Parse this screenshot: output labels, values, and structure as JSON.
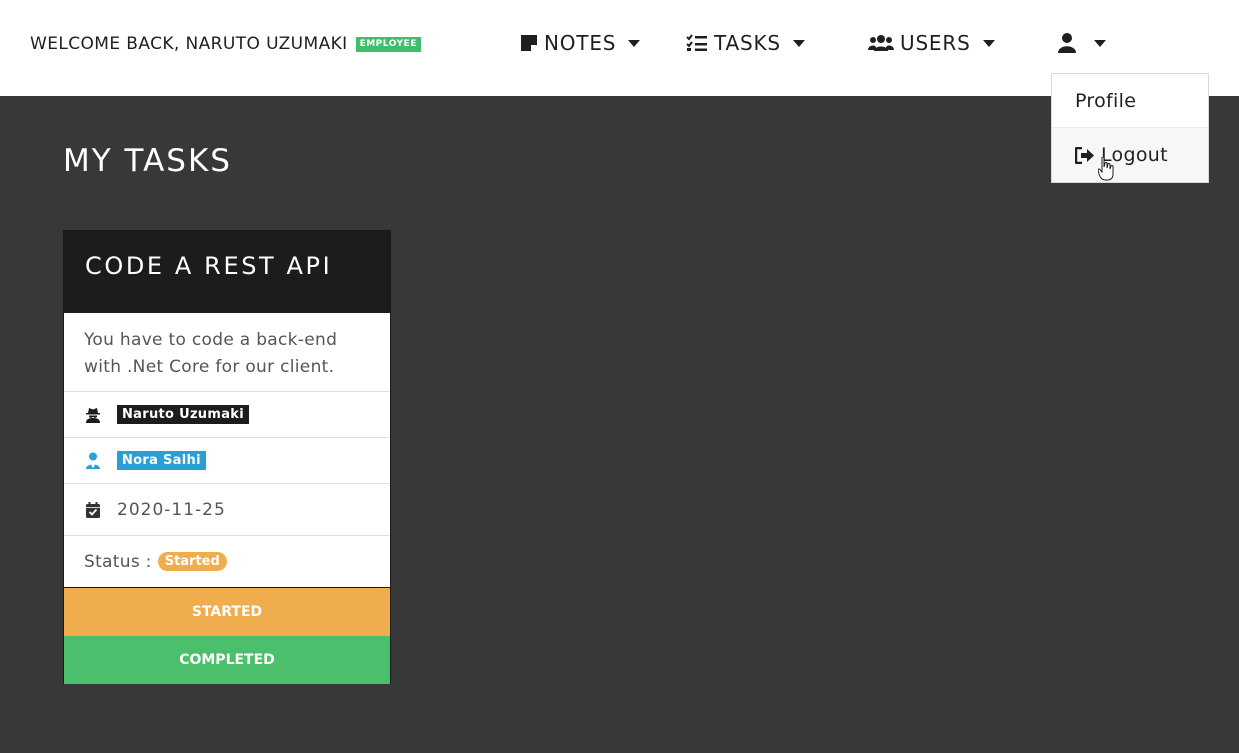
{
  "header": {
    "welcome": "WELCOME BACK, NARUTO UZUMAKI",
    "role_badge": "EMPLOYEE"
  },
  "nav": {
    "notes": "NOTES",
    "tasks": "TASKS",
    "users": "USERS"
  },
  "user_menu": {
    "profile": "Profile",
    "logout": "Logout"
  },
  "page": {
    "title": "MY TASKS"
  },
  "task": {
    "title": "CODE A REST API",
    "description": "You have to code a back-end with .Net Core for our client.",
    "assignee": "Naruto Uzumaki",
    "creator": "Nora Salhi",
    "due_date": "2020-11-25",
    "status_label": "Status :",
    "status_value": "Started",
    "btn_started": "STARTED",
    "btn_completed": "COMPLETED"
  },
  "colors": {
    "nav_bg": "#ffffff",
    "page_bg": "#383838",
    "card_header_bg": "#1c1c1c",
    "employee_badge": "#3fbf6a",
    "started": "#f0ad4e",
    "completed": "#4bbf6b",
    "creator_badge": "#2a9fd6"
  },
  "icons": {
    "notes": "sticky-note-icon",
    "tasks": "tasks-list-icon",
    "users": "users-icon",
    "user_menu": "user-icon",
    "logout": "sign-out-icon",
    "assignee": "user-secret-icon",
    "creator": "user-tie-icon",
    "date": "calendar-check-icon"
  }
}
